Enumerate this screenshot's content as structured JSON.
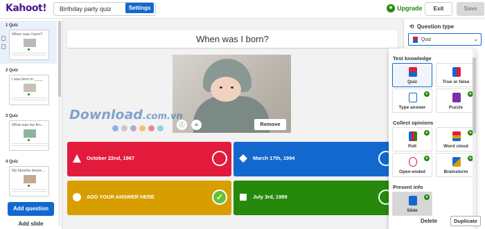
{
  "header": {
    "logo": "Kahoot!",
    "quiz_title": "Birthday party quiz",
    "settings_label": "Settings",
    "upgrade_label": "Upgrade",
    "exit_label": "Exit",
    "save_label": "Save"
  },
  "sidebar": {
    "slides": [
      {
        "label": "1 Quiz",
        "question": "When was I born?"
      },
      {
        "label": "2 Quiz",
        "question": "I was born in ____"
      },
      {
        "label": "3 Quiz",
        "question": "What was my firs..."
      },
      {
        "label": "4 Quiz",
        "question": "My favorite desse..."
      }
    ],
    "add_question_label": "Add question",
    "add_slide_label": "Add slide"
  },
  "main": {
    "question": "When was I born?",
    "remove_label": "Remove",
    "watermark": "Download",
    "watermark_suffix": ".com.vn",
    "answers": [
      {
        "text": "October 22nd, 1967",
        "color": "#e21b3c",
        "shape": "triangle"
      },
      {
        "text": "March 17th, 1994",
        "color": "#1368ce",
        "shape": "diamond"
      },
      {
        "text": "ADD YOUR ANSWER HERE",
        "color": "#d89e00",
        "shape": "circle",
        "correct": true
      },
      {
        "text": "July 3rd, 1989",
        "color": "#26890c",
        "shape": "square"
      }
    ]
  },
  "right_panel": {
    "question_type_label": "Question type",
    "selected_type": "Quiz",
    "sections": {
      "test": "Test knowledge",
      "collect": "Collect opinions",
      "present": "Present info"
    },
    "options": {
      "quiz": "Quiz",
      "true_false": "True or false",
      "type_answer": "Type answer",
      "puzzle": "Puzzle",
      "poll": "Poll",
      "word_cloud": "Word cloud",
      "open_ended": "Open-ended",
      "brainstorm": "Brainstorm",
      "slide": "Slide"
    },
    "delete_label": "Delete",
    "duplicate_label": "Duplicate"
  }
}
